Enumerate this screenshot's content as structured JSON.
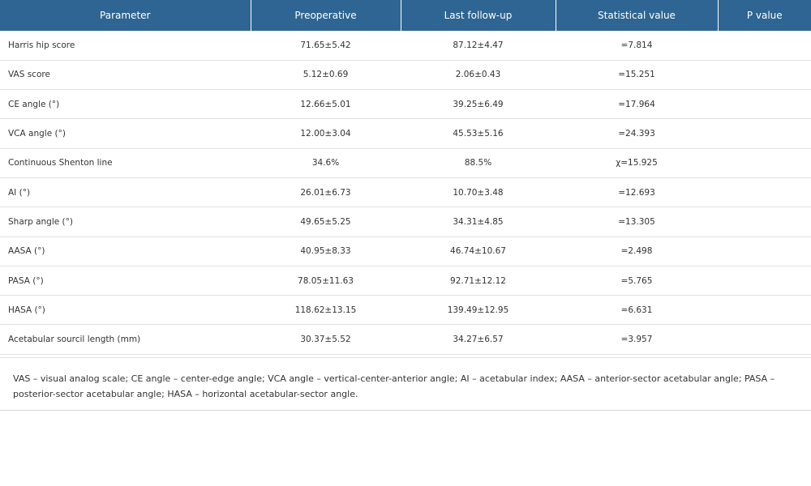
{
  "table": {
    "headers": [
      "Parameter",
      "Preoperative",
      "Last follow-up",
      "Statistical value",
      "P value"
    ],
    "rows": [
      {
        "parameter": "Harris hip score",
        "preoperative": "71.65±5.42",
        "last_follow_up": "87.12±4.47",
        "statistical_value": "=7.814",
        "p_value": ""
      },
      {
        "parameter": "VAS score",
        "preoperative": "5.12±0.69",
        "last_follow_up": "2.06±0.43",
        "statistical_value": "=15.251",
        "p_value": ""
      },
      {
        "parameter": "CE angle (°)",
        "preoperative": "12.66±5.01",
        "last_follow_up": "39.25±6.49",
        "statistical_value": "=17.964",
        "p_value": ""
      },
      {
        "parameter": "VCA angle (°)",
        "preoperative": "12.00±3.04",
        "last_follow_up": "45.53±5.16",
        "statistical_value": "=24.393",
        "p_value": ""
      },
      {
        "parameter": "Continuous Shenton line",
        "preoperative": "34.6%",
        "last_follow_up": "88.5%",
        "statistical_value": "χ=15.925",
        "p_value": ""
      },
      {
        "parameter": "AI (°)",
        "preoperative": "26.01±6.73",
        "last_follow_up": "10.70±3.48",
        "statistical_value": "=12.693",
        "p_value": ""
      },
      {
        "parameter": "Sharp angle (°)",
        "preoperative": "49.65±5.25",
        "last_follow_up": "34.31±4.85",
        "statistical_value": "=13.305",
        "p_value": ""
      },
      {
        "parameter": "AASA (°)",
        "preoperative": "40.95±8.33",
        "last_follow_up": "46.74±10.67",
        "statistical_value": "=2.498",
        "p_value": ""
      },
      {
        "parameter": "PASA (°)",
        "preoperative": "78.05±11.63",
        "last_follow_up": "92.71±12.12",
        "statistical_value": "=5.765",
        "p_value": ""
      },
      {
        "parameter": "HASA (°)",
        "preoperative": "118.62±13.15",
        "last_follow_up": "139.49±12.95",
        "statistical_value": "=6.631",
        "p_value": ""
      },
      {
        "parameter": "Acetabular sourcil length (mm)",
        "preoperative": "30.37±5.52",
        "last_follow_up": "34.27±6.57",
        "statistical_value": "=3.957",
        "p_value": ""
      }
    ],
    "footnote": "VAS – visual analog scale; CE angle – center-edge angle; VCA angle – vertical-center-anterior angle; AI – acetabular index; AASA – anterior-sector acetabular angle; PASA – posterior-sector acetabular angle; HASA – horizontal acetabular-sector angle."
  },
  "colors": {
    "header_background": "#2e6592",
    "header_text": "#ffffff",
    "row_divider": "#e1e1e1",
    "body_text": "#333333"
  }
}
